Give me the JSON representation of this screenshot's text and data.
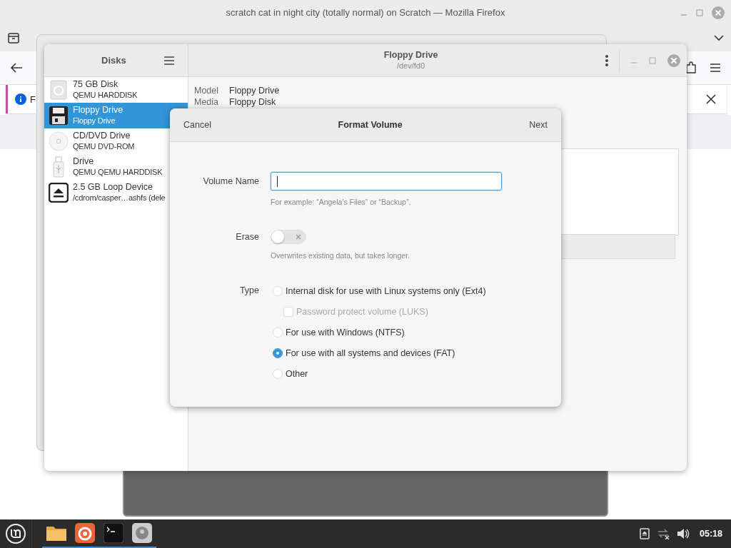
{
  "firefox": {
    "title": "scratch cat in night city (totally normal) on Scratch — Mozilla Firefox",
    "notification_text": "F"
  },
  "disks": {
    "sidebar_title": "Disks",
    "title": "Floppy Drive",
    "subtitle": "/dev/fd0",
    "drives": [
      {
        "name": "75 GB Disk",
        "detail": "QEMU HARDDISK",
        "kind": "harddisk",
        "selected": false
      },
      {
        "name": "Floppy Drive",
        "detail": "Floppy Drive",
        "kind": "floppy",
        "selected": true
      },
      {
        "name": "CD/DVD Drive",
        "detail": "QEMU DVD-ROM",
        "kind": "optical",
        "selected": false
      },
      {
        "name": "Drive",
        "detail": "QEMU QEMU HARDDISK",
        "kind": "usb",
        "selected": false
      },
      {
        "name": "2.5 GB Loop Device",
        "detail": "/cdrom/casper…ashfs (dele",
        "kind": "loop",
        "selected": false
      }
    ],
    "details": [
      {
        "label": "Model",
        "value": "Floppy Drive"
      },
      {
        "label": "Media",
        "value": "Floppy Disk"
      }
    ]
  },
  "dialog": {
    "title": "Format Volume",
    "cancel": "Cancel",
    "next": "Next",
    "volume_name": {
      "label": "Volume Name",
      "hint": "For example: “Angela's Files” or “Backup”."
    },
    "erase": {
      "label": "Erase",
      "on": false,
      "hint": "Overwrites existing data, but takes longer."
    },
    "type": {
      "label": "Type",
      "options": [
        {
          "kind": "radio",
          "label": "Internal disk for use with Linux systems only (Ext4)",
          "selected": false
        },
        {
          "kind": "checkbox",
          "label": "Password protect volume (LUKS)",
          "checked": false,
          "disabled": true
        },
        {
          "kind": "radio",
          "label": "For use with Windows (NTFS)",
          "selected": false
        },
        {
          "kind": "radio",
          "label": "For use with all systems and devices (FAT)",
          "selected": true
        },
        {
          "kind": "radio",
          "label": "Other",
          "selected": false
        }
      ]
    }
  },
  "taskbar": {
    "clock": "05:18"
  }
}
